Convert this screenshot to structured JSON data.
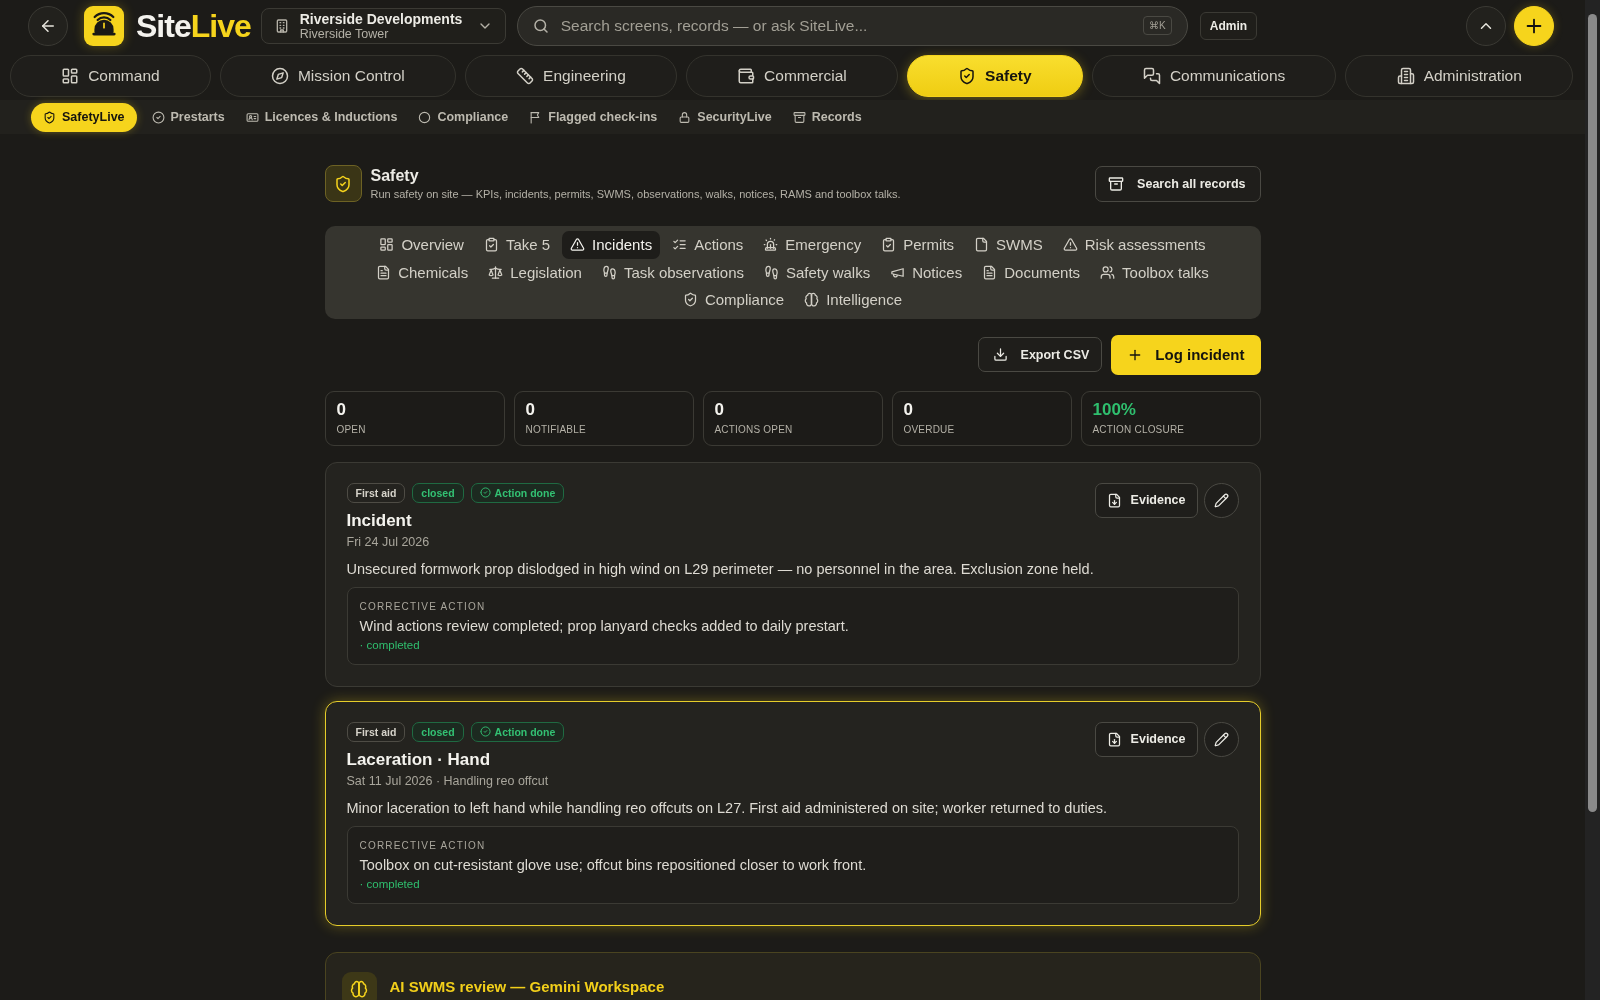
{
  "header": {
    "brand": {
      "part_1": "Site",
      "part_2": "Live"
    },
    "project": {
      "name": "Riverside Developments",
      "site": "Riverside Tower"
    },
    "search": {
      "placeholder": "Search screens, records — or ask SiteLive...",
      "shortcut": "⌘K"
    },
    "role_badge": "Admin"
  },
  "modules": [
    {
      "label": "Command",
      "selected": false
    },
    {
      "label": "Mission Control",
      "selected": false
    },
    {
      "label": "Engineering",
      "selected": false
    },
    {
      "label": "Commercial",
      "selected": false
    },
    {
      "label": "Safety",
      "selected": true
    },
    {
      "label": "Communications",
      "selected": false
    },
    {
      "label": "Administration",
      "selected": false
    }
  ],
  "sub_nav": [
    {
      "label": "SafetyLive",
      "selected": true
    },
    {
      "label": "Prestarts",
      "selected": false
    },
    {
      "label": "Licences & Inductions",
      "selected": false
    },
    {
      "label": "Compliance",
      "selected": false
    },
    {
      "label": "Flagged check-ins",
      "selected": false
    },
    {
      "label": "SecurityLive",
      "selected": false
    },
    {
      "label": "Records",
      "selected": false
    }
  ],
  "page": {
    "title": "Safety",
    "subtitle": "Run safety on site — KPIs, incidents, permits, SWMS, observations, walks, notices, RAMS and toolbox talks.",
    "search_button": "Search all records"
  },
  "tabs": [
    {
      "label": "Overview",
      "selected": false
    },
    {
      "label": "Take 5",
      "selected": false
    },
    {
      "label": "Incidents",
      "selected": true
    },
    {
      "label": "Actions",
      "selected": false
    },
    {
      "label": "Emergency",
      "selected": false
    },
    {
      "label": "Permits",
      "selected": false
    },
    {
      "label": "SWMS",
      "selected": false
    },
    {
      "label": "Risk assessments",
      "selected": false
    },
    {
      "label": "Chemicals",
      "selected": false
    },
    {
      "label": "Legislation",
      "selected": false
    },
    {
      "label": "Task observations",
      "selected": false
    },
    {
      "label": "Safety walks",
      "selected": false
    },
    {
      "label": "Notices",
      "selected": false
    },
    {
      "label": "Documents",
      "selected": false
    },
    {
      "label": "Toolbox talks",
      "selected": false
    },
    {
      "label": "Compliance",
      "selected": false
    },
    {
      "label": "Intelligence",
      "selected": false
    }
  ],
  "actions": {
    "export": "Export CSV",
    "log": "Log incident"
  },
  "stats": [
    {
      "value": "0",
      "label": "OPEN",
      "kind": "count"
    },
    {
      "value": "0",
      "label": "NOTIFIABLE",
      "kind": "count"
    },
    {
      "value": "0",
      "label": "ACTIONS OPEN",
      "kind": "count"
    },
    {
      "value": "0",
      "label": "OVERDUE",
      "kind": "count"
    },
    {
      "value": "100%",
      "label": "ACTION CLOSURE",
      "kind": "rate"
    }
  ],
  "incidents": [
    {
      "highlighted": false,
      "badges": [
        {
          "label": "First aid",
          "kind": "type"
        },
        {
          "label": "closed",
          "kind": "status"
        },
        {
          "label": "Action done",
          "kind": "action"
        }
      ],
      "title": "Incident",
      "meta": "Fri 24 Jul 2026",
      "description": "Unsecured formwork prop dislodged in high wind on L29 perimeter — no personnel in the area. Exclusion zone held.",
      "corrective_action": {
        "heading": "CORRECTIVE ACTION",
        "text": "Wind actions review completed; prop lanyard checks added to daily prestart.",
        "status": "· completed"
      },
      "evidence_button": "Evidence"
    },
    {
      "highlighted": true,
      "badges": [
        {
          "label": "First aid",
          "kind": "type"
        },
        {
          "label": "closed",
          "kind": "status"
        },
        {
          "label": "Action done",
          "kind": "action"
        }
      ],
      "title": "Laceration · Hand",
      "meta": "Sat 11 Jul 2026 · Handling reo offcut",
      "description": "Minor laceration to left hand while handling reo offcuts on L27. First aid administered on site; worker returned to duties.",
      "corrective_action": {
        "heading": "CORRECTIVE ACTION",
        "text": "Toolbox on cut-resistant glove use; offcut bins repositioned closer to work front.",
        "status": "· completed"
      },
      "evidence_button": "Evidence"
    }
  ],
  "ai_panel": {
    "title": "AI SWMS review — Gemini Workspace"
  }
}
